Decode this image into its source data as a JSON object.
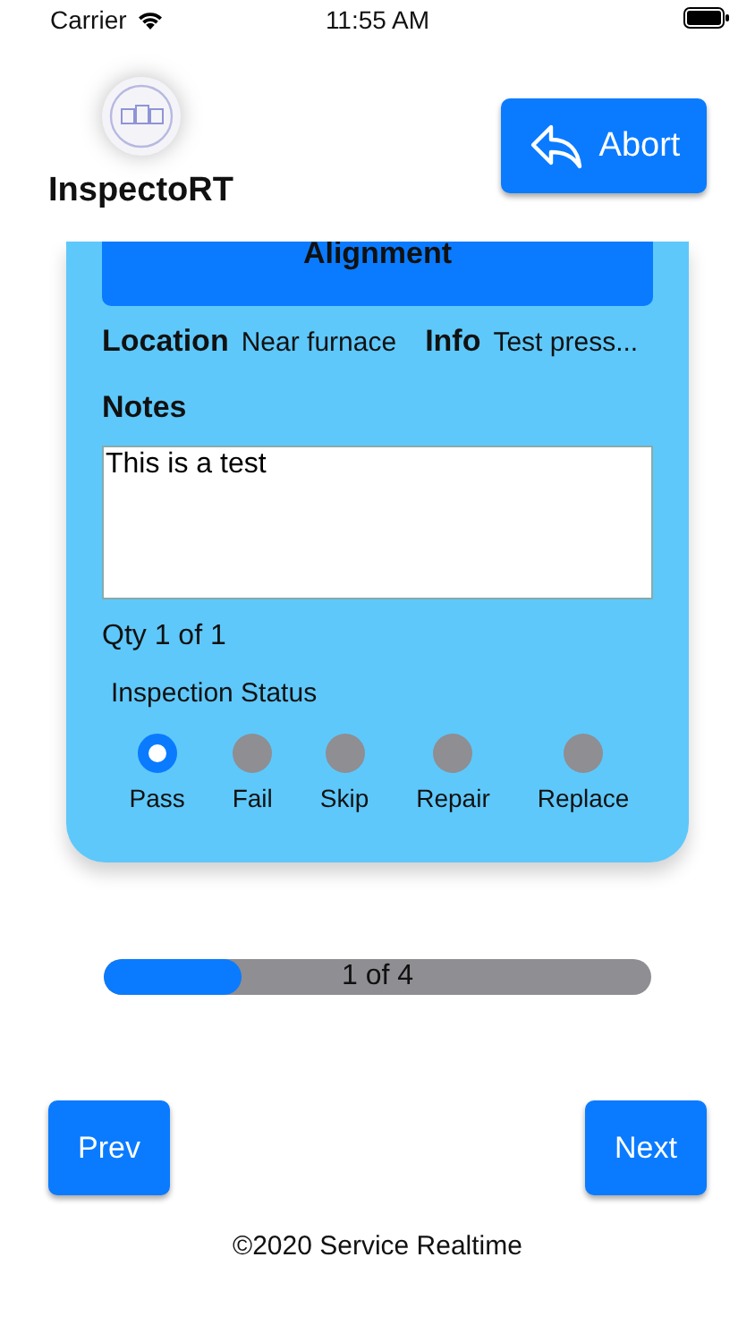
{
  "status_bar": {
    "carrier": "Carrier",
    "time": "11:55 AM"
  },
  "header": {
    "app_name": "InspectoRT",
    "abort_button": "Abort"
  },
  "card": {
    "title": "Alignment",
    "location_label": "Location",
    "location_value": "Near furnace",
    "info_label": "Info",
    "info_value": "Test press...",
    "notes_label": "Notes",
    "notes_value": "This is a test",
    "quantity": "Qty 1 of 1",
    "status_label": "Inspection Status",
    "statuses": [
      {
        "label": "Pass",
        "selected": true
      },
      {
        "label": "Fail",
        "selected": false
      },
      {
        "label": "Skip",
        "selected": false
      },
      {
        "label": "Repair",
        "selected": false
      },
      {
        "label": "Replace",
        "selected": false
      }
    ]
  },
  "progress": {
    "level": 0.25,
    "label": "1 of 4"
  },
  "buttons": {
    "prev": "Prev",
    "next": "Next"
  },
  "footer": "©2020 Service Realtime"
}
